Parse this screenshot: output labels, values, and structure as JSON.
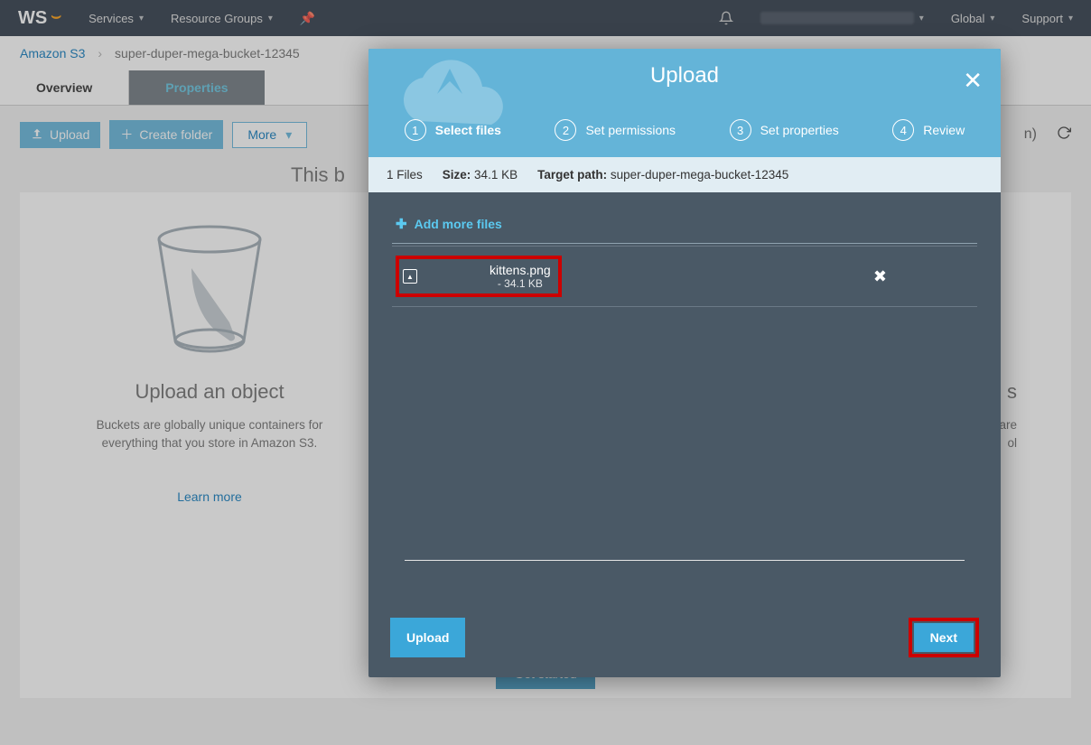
{
  "topnav": {
    "logo": "WS",
    "services": "Services",
    "resource_groups": "Resource Groups",
    "global": "Global",
    "support": "Support"
  },
  "breadcrumb": {
    "root": "Amazon S3",
    "bucket": "super-duper-mega-bucket-12345"
  },
  "tabs": {
    "overview": "Overview",
    "properties": "Properties"
  },
  "toolbar": {
    "upload": "Upload",
    "create_folder": "Create folder",
    "more": "More",
    "region_suffix": "n)"
  },
  "empty": {
    "heading": "This b",
    "card1_title": "Upload an object",
    "card1_desc": "Buckets are globally unique containers for everything that you store in Amazon S3.",
    "learn_more": "Learn more",
    "card2_title": "s",
    "card2_desc": "are\nol",
    "get_started": "Get started"
  },
  "modal": {
    "title": "Upload",
    "steps": {
      "s1": "Select files",
      "s2": "Set permissions",
      "s3": "Set properties",
      "s4": "Review"
    },
    "info": {
      "files_count": "1 Files",
      "size_label": "Size:",
      "size_value": "34.1 KB",
      "target_label": "Target path:",
      "target_value": "super-duper-mega-bucket-12345"
    },
    "add_more": "Add more files",
    "file": {
      "name": "kittens.png",
      "meta": "- 34.1 KB"
    },
    "footer": {
      "upload": "Upload",
      "next": "Next"
    }
  }
}
